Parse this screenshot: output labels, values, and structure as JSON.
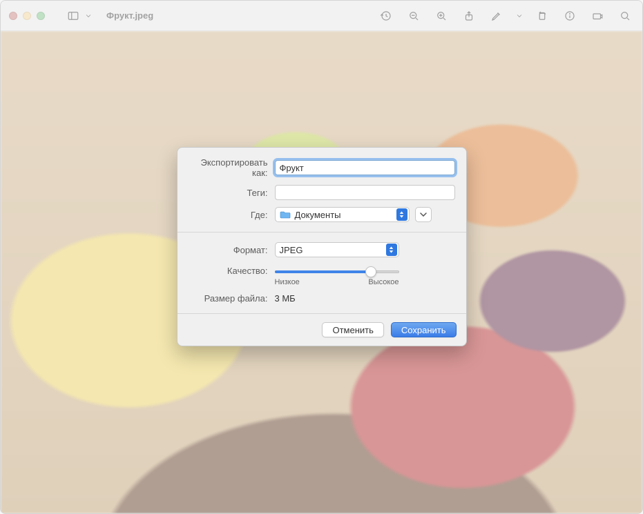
{
  "titlebar": {
    "filename": "Фрукт.jpeg"
  },
  "dialog": {
    "export_as_label": "Экспортировать как:",
    "export_as_value": "Фрукт",
    "tags_label": "Теги:",
    "tags_value": "",
    "where_label": "Где:",
    "where_value": "Документы",
    "format_label": "Формат:",
    "format_value": "JPEG",
    "quality_label": "Качество:",
    "quality_low": "Низкое",
    "quality_high": "Высокое",
    "quality_value_pct": 80,
    "filesize_label": "Размер файла:",
    "filesize_value": "3 МБ",
    "cancel": "Отменить",
    "save": "Сохранить"
  },
  "icons": {
    "sidebar": "sidebar-icon",
    "recent": "recent-icon",
    "zoom_out": "zoom-out-icon",
    "zoom_in": "zoom-in-icon",
    "share": "share-icon",
    "markup": "markup-icon",
    "rotate": "rotate-icon",
    "info": "info-icon",
    "highlight": "highlight-icon",
    "search": "search-icon"
  }
}
